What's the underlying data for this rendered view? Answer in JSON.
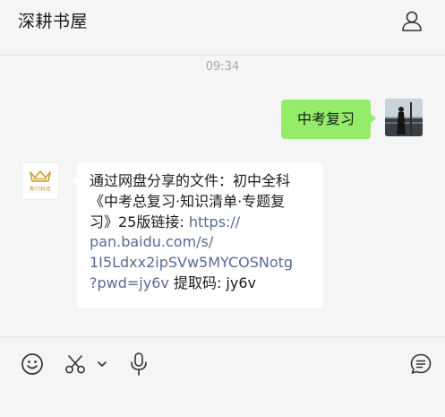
{
  "header": {
    "title": "深耕书屋",
    "profile_icon": "profile-icon"
  },
  "chat": {
    "timestamp": "09:34",
    "sent_message": "中考复习",
    "received_message": {
      "lines": [
        "通过网盘分享的文件：初中全科",
        "《中考总复习·知识清单·专题复",
        "习》25版链接: "
      ],
      "link_parts": [
        "https://",
        "pan.baidu.com/s/",
        "1I5Ldxx2ipSVw5MYCOSNotg",
        "?pwd=jy6v"
      ],
      "tail": " 提取码: jy6v"
    },
    "other_avatar_text": "新行科技",
    "link_color": "#576b95",
    "sent_bubble_color": "#95ec69"
  },
  "toolbar": {
    "icons": [
      "emoji-icon",
      "scissors-icon",
      "chevron-down-icon",
      "microphone-icon",
      "chat-history-icon"
    ]
  }
}
